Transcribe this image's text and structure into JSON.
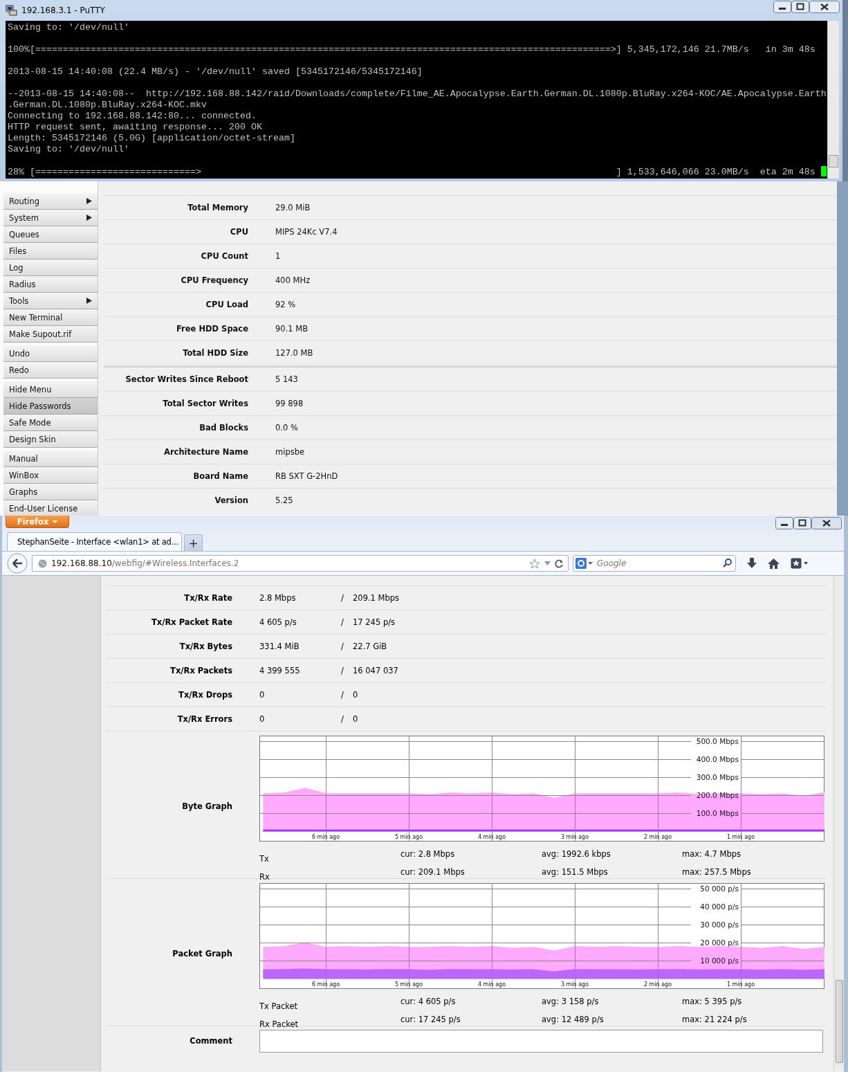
{
  "putty": {
    "title": "192.168.3.1 - PuTTY",
    "lines": [
      {
        "kind": "text",
        "text": "Saving to: '/dev/null'"
      },
      {
        "kind": "blank"
      },
      {
        "kind": "text",
        "text": "100%[========================================================================================================>] 5,345,172,146 21.7MB/s   in 3m 48s"
      },
      {
        "kind": "blank"
      },
      {
        "kind": "text",
        "text": "2013-08-15 14:40:08 (22.4 MB/s) - '/dev/null' saved [5345172146/5345172146]"
      },
      {
        "kind": "blank"
      },
      {
        "kind": "text",
        "text": "--2013-08-15 14:40:08--  http://192.168.88.142/raid/Downloads/complete/Filme_AE.Apocalypse.Earth.German.DL.1080p.BluRay.x264-KOC/AE.Apocalypse.Earth"
      },
      {
        "kind": "text",
        "text": ".German.DL.1080p.BluRay.x264-KOC.mkv"
      },
      {
        "kind": "text",
        "text": "Connecting to 192.168.88.142:80... connected."
      },
      {
        "kind": "text",
        "text": "HTTP request sent, awaiting response... 200 OK"
      },
      {
        "kind": "text",
        "text": "Length: 5345172146 (5.0G) [application/octet-stream]"
      },
      {
        "kind": "text",
        "text": "Saving to: '/dev/null'"
      },
      {
        "kind": "blank"
      },
      {
        "kind": "text",
        "text": "28% [=============================>                                                                           ] 1,533,646,066 23.0MB/s  eta 2m 48s"
      }
    ]
  },
  "webfig": {
    "menu_groups": [
      {
        "items": [
          {
            "label": "Routing",
            "submenu": true,
            "highlighted": false
          },
          {
            "label": "System",
            "submenu": true,
            "highlighted": false
          },
          {
            "label": "Queues",
            "submenu": false,
            "highlighted": false
          },
          {
            "label": "Files",
            "submenu": false,
            "highlighted": false
          },
          {
            "label": "Log",
            "submenu": false,
            "highlighted": false
          },
          {
            "label": "Radius",
            "submenu": false,
            "highlighted": false
          },
          {
            "label": "Tools",
            "submenu": true,
            "highlighted": false
          },
          {
            "label": "New Terminal",
            "submenu": false,
            "highlighted": false
          },
          {
            "label": "Make Supout.rif",
            "submenu": false,
            "highlighted": false
          }
        ]
      },
      {
        "items": [
          {
            "label": "Undo",
            "submenu": false,
            "highlighted": false
          },
          {
            "label": "Redo",
            "submenu": false,
            "highlighted": false
          }
        ]
      },
      {
        "items": [
          {
            "label": "Hide Menu",
            "submenu": false,
            "highlighted": false
          },
          {
            "label": "Hide Passwords",
            "submenu": false,
            "highlighted": true
          },
          {
            "label": "Safe Mode",
            "submenu": false,
            "highlighted": false
          },
          {
            "label": "Design Skin",
            "submenu": false,
            "highlighted": false
          }
        ]
      },
      {
        "items": [
          {
            "label": "Manual",
            "submenu": false,
            "highlighted": false
          },
          {
            "label": "WinBox",
            "submenu": false,
            "highlighted": false
          },
          {
            "label": "Graphs",
            "submenu": false,
            "highlighted": false
          },
          {
            "label": "End-User License",
            "submenu": false,
            "highlighted": false
          }
        ]
      }
    ],
    "sections": [
      {
        "rows": [
          {
            "label": "Total Memory",
            "value": "29.0 MiB"
          },
          {
            "label": "CPU",
            "value": "MIPS 24Kc V7.4"
          },
          {
            "label": "CPU Count",
            "value": "1"
          },
          {
            "label": "CPU Frequency",
            "value": "400 MHz"
          },
          {
            "label": "CPU Load",
            "value": "92 %"
          },
          {
            "label": "Free HDD Space",
            "value": "90.1 MB"
          },
          {
            "label": "Total HDD Size",
            "value": "127.0 MB"
          }
        ]
      },
      {
        "rows": [
          {
            "label": "Sector Writes Since Reboot",
            "value": "5 143"
          },
          {
            "label": "Total Sector Writes",
            "value": "99 898"
          },
          {
            "label": "Bad Blocks",
            "value": "0.0 %"
          },
          {
            "label": "Architecture Name",
            "value": "mipsbe"
          },
          {
            "label": "Board Name",
            "value": "RB SXT G-2HnD"
          },
          {
            "label": "Version",
            "value": "5.25"
          }
        ]
      }
    ]
  },
  "firefox": {
    "button": "Firefox",
    "tab": {
      "title": "StephanSeite - Interface <wlan1> at ad...",
      "selected": true
    },
    "new_tab": "+",
    "url": {
      "host": "192.168.88.10",
      "path": "/webfig/#Wireless.Interfaces.2"
    },
    "search": {
      "placeholder": "Google"
    },
    "rows": [
      {
        "label": "Tx/Rx Rate",
        "tx": "2.8 Mbps",
        "separator": "/",
        "rx": "209.1 Mbps"
      },
      {
        "label": "Tx/Rx Packet Rate",
        "tx": "4 605 p/s",
        "separator": "/",
        "rx": "17 245 p/s"
      },
      {
        "label": "Tx/Rx Bytes",
        "tx": "331.4 MiB",
        "separator": "/",
        "rx": "22.7 GiB"
      },
      {
        "label": "Tx/Rx Packets",
        "tx": "4 399 555",
        "separator": "/",
        "rx": "16 047 037"
      },
      {
        "label": "Tx/Rx Drops",
        "tx": "0",
        "separator": "/",
        "rx": "0"
      },
      {
        "label": "Tx/Rx Errors",
        "tx": "0",
        "separator": "/",
        "rx": "0"
      }
    ],
    "graphs": [
      {
        "label": "Byte Graph",
        "chart_data": {
          "type": "area",
          "grid": true,
          "xlim": [
            -6.79,
            0
          ],
          "ylim": [
            0,
            525
          ],
          "x": [
            -6.75,
            -6.5,
            -6.25,
            -6,
            -5.75,
            -5.5,
            -5.25,
            -5,
            -4.75,
            -4.5,
            -4.25,
            -4,
            -3.75,
            -3.5,
            -3.25,
            -3,
            -2.75,
            -2.5,
            -2.25,
            -2,
            -1.75,
            -1.5,
            -1.25,
            -1,
            -0.75,
            -0.5,
            -0.25,
            0
          ],
          "xticks": [
            {
              "value": -6,
              "label": "6 min ago"
            },
            {
              "value": -5,
              "label": "5 min ago"
            },
            {
              "value": -4,
              "label": "4 min ago"
            },
            {
              "value": -3,
              "label": "3 min ago"
            },
            {
              "value": -2,
              "label": "2 min ago"
            },
            {
              "value": -1,
              "label": "1 min ago"
            }
          ],
          "yticks": [
            {
              "value": 100,
              "label": "100.0 Mbps"
            },
            {
              "value": 200,
              "label": "200.0 Mbps"
            },
            {
              "value": 300,
              "label": "300.0 Mbps"
            },
            {
              "value": 400,
              "label": "400.0 Mbps"
            },
            {
              "value": 500,
              "label": "500.0 Mbps"
            }
          ],
          "series": [
            {
              "name": "Tx",
              "color": "#9933ff",
              "values": [
                3,
                3,
                3,
                3,
                3,
                3,
                3,
                3,
                3,
                3,
                3,
                3,
                3,
                3,
                3,
                3,
                3,
                3,
                3,
                3,
                3,
                3,
                3,
                3,
                3,
                3,
                3,
                3
              ]
            },
            {
              "name": "Rx",
              "color": "#ffaaff",
              "values": [
                205,
                210,
                235,
                205,
                205,
                205,
                205,
                205,
                200,
                210,
                205,
                210,
                200,
                205,
                180,
                205,
                205,
                205,
                205,
                205,
                210,
                200,
                205,
                205,
                200,
                205,
                190,
                210
              ]
            }
          ]
        },
        "legend": [
          {
            "cur": "cur: 2.8 Mbps",
            "avg": "avg: 1992.6 kbps",
            "max": "max: 4.7 Mbps"
          },
          {
            "cur": "cur: 209.1 Mbps",
            "avg": "avg: 151.5 Mbps",
            "max": "max: 257.5 Mbps"
          }
        ]
      },
      {
        "label": "Packet Graph",
        "chart_data": {
          "type": "area",
          "grid": true,
          "xlim": [
            -6.79,
            0
          ],
          "ylim": [
            0,
            52500
          ],
          "x": [
            -6.75,
            -6.5,
            -6.25,
            -6,
            -5.75,
            -5.5,
            -5.25,
            -5,
            -4.75,
            -4.5,
            -4.25,
            -4,
            -3.75,
            -3.5,
            -3.25,
            -3,
            -2.75,
            -2.5,
            -2.25,
            -2,
            -1.75,
            -1.5,
            -1.25,
            -1,
            -0.75,
            -0.5,
            -0.25,
            0
          ],
          "xticks": [
            {
              "value": -6,
              "label": "6 min ago"
            },
            {
              "value": -5,
              "label": "5 min ago"
            },
            {
              "value": -4,
              "label": "4 min ago"
            },
            {
              "value": -3,
              "label": "3 min ago"
            },
            {
              "value": -2,
              "label": "2 min ago"
            },
            {
              "value": -1,
              "label": "1 min ago"
            }
          ],
          "yticks": [
            {
              "value": 10000,
              "label": "10 000 p/s"
            },
            {
              "value": 20000,
              "label": "20 000 p/s"
            },
            {
              "value": 30000,
              "label": "30 000 p/s"
            },
            {
              "value": 40000,
              "label": "40 000 p/s"
            },
            {
              "value": 50000,
              "label": "50 000 p/s"
            }
          ],
          "series": [
            {
              "name": "Tx Packet",
              "color": "#bb66ff",
              "values": [
                4500,
                4700,
                5000,
                4600,
                4600,
                4500,
                4700,
                4600,
                4300,
                4700,
                4600,
                4600,
                4500,
                4600,
                3500,
                4700,
                4600,
                4600,
                4500,
                4600,
                4700,
                4500,
                4600,
                4600,
                4400,
                4700,
                4300,
                4600
              ]
            },
            {
              "name": "Rx Packet",
              "color": "#ffaaff",
              "values": [
                17000,
                17500,
                19500,
                17000,
                17500,
                17000,
                17500,
                17000,
                17000,
                17500,
                17000,
                17500,
                16500,
                17000,
                15000,
                17500,
                17000,
                17500,
                17000,
                17000,
                17500,
                17000,
                17500,
                17000,
                16500,
                17500,
                16000,
                17000
              ]
            }
          ]
        },
        "legend": [
          {
            "cur": "cur: 4 605 p/s",
            "avg": "avg: 3 158 p/s",
            "max": "max: 5 395 p/s"
          },
          {
            "cur": "cur: 17 245 p/s",
            "avg": "avg: 12 489 p/s",
            "max": "max: 21 224 p/s"
          }
        ]
      }
    ],
    "comment": {
      "label": "Comment"
    }
  }
}
